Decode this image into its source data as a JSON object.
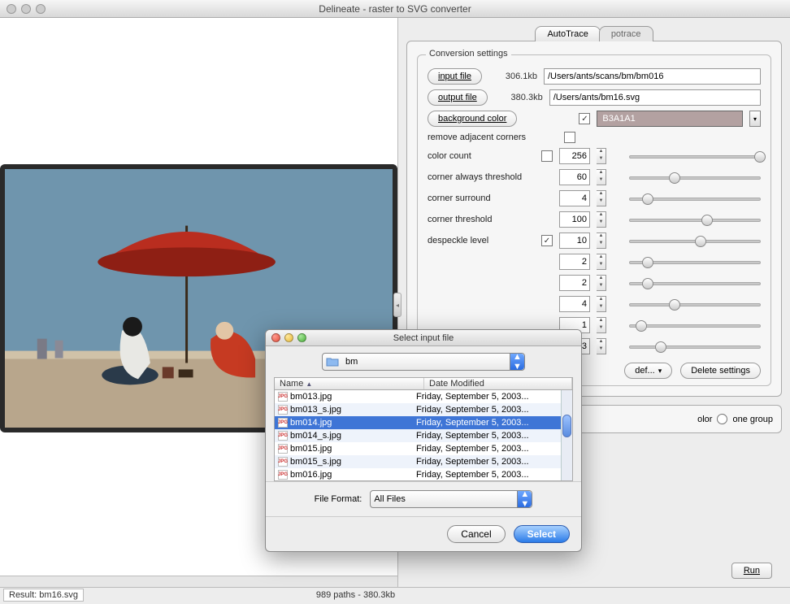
{
  "window": {
    "title": "Delineate - raster to SVG converter"
  },
  "tabs": {
    "autotrace": "AutoTrace",
    "potrace": "potrace"
  },
  "settings": {
    "legend": "Conversion settings",
    "input_btn": "input file",
    "input_size": "306.1kb",
    "input_path": "/Users/ants/scans/bm/bm016",
    "output_btn": "output file",
    "output_size": "380.3kb",
    "output_path": "/Users/ants/bm16.svg",
    "bgcolor_btn": "background color",
    "bgcolor_value": "B3A1A1",
    "remove_adjacent": "remove adjacent corners",
    "rows": [
      {
        "label": "color count",
        "check": false,
        "value": "256",
        "thumb": 95
      },
      {
        "label": "corner always threshold",
        "value": "60",
        "thumb": 30
      },
      {
        "label": "corner surround",
        "value": "4",
        "thumb": 10
      },
      {
        "label": "corner threshold",
        "value": "100",
        "thumb": 55
      },
      {
        "label": "despeckle level",
        "check": true,
        "value": "10",
        "thumb": 50
      },
      {
        "label": "",
        "value": "2",
        "thumb": 10
      },
      {
        "label": "",
        "value": "2",
        "thumb": 10
      },
      {
        "label": "",
        "value": "4",
        "thumb": 30
      },
      {
        "label": "",
        "value": "1",
        "thumb": 5
      },
      {
        "label": "",
        "value": "3",
        "thumb": 20
      }
    ],
    "def_btn": "def...",
    "delete_btn": "Delete settings"
  },
  "run_panel": {
    "color_label": "olor",
    "onegroup_label": "one group",
    "run_btn": "Run"
  },
  "status": {
    "result": "Result: bm16.svg",
    "paths": "989 paths - 380.3kb"
  },
  "dialog": {
    "title": "Select input file",
    "folder": "bm",
    "col_name": "Name",
    "col_date": "Date Modified",
    "files": [
      {
        "name": "bm013.jpg",
        "date": "Friday, September 5, 2003..."
      },
      {
        "name": "bm013_s.jpg",
        "date": "Friday, September 5, 2003..."
      },
      {
        "name": "bm014.jpg",
        "date": "Friday, September 5, 2003...",
        "selected": true
      },
      {
        "name": "bm014_s.jpg",
        "date": "Friday, September 5, 2003..."
      },
      {
        "name": "bm015.jpg",
        "date": "Friday, September 5, 2003..."
      },
      {
        "name": "bm015_s.jpg",
        "date": "Friday, September 5, 2003..."
      },
      {
        "name": "bm016.jpg",
        "date": "Friday, September 5, 2003..."
      }
    ],
    "format_label": "File Format:",
    "format_value": "All Files",
    "cancel": "Cancel",
    "select": "Select"
  }
}
